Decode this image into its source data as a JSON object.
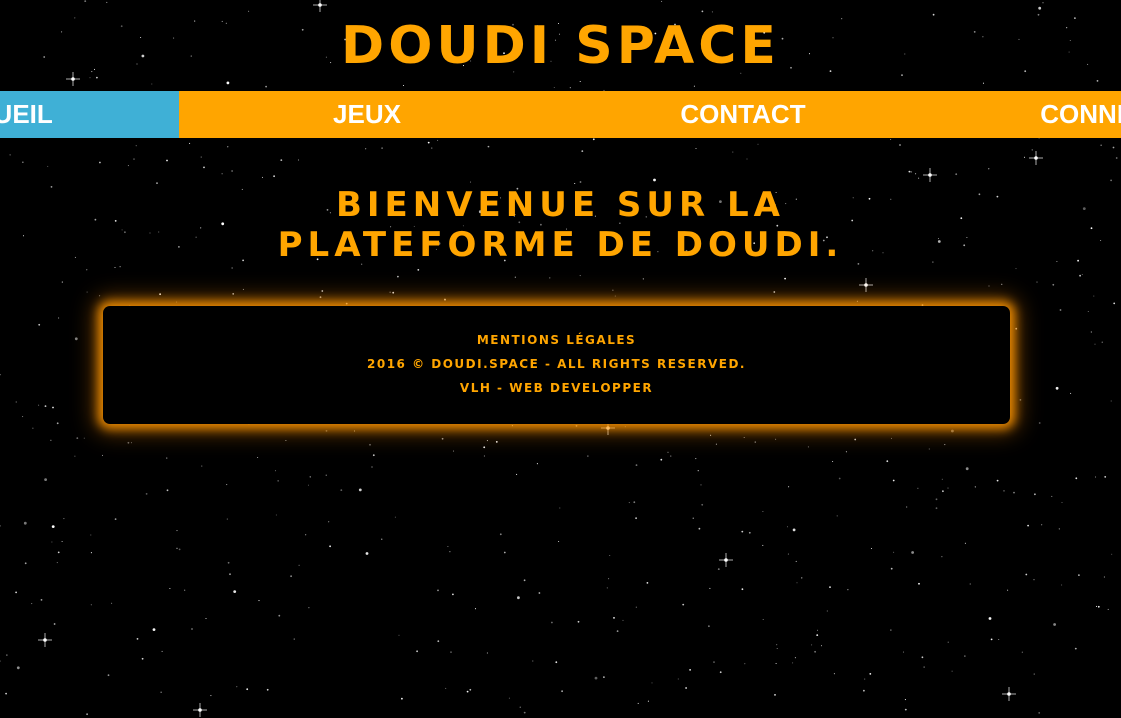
{
  "site": {
    "title": "DOUDI SPACE"
  },
  "nav": {
    "items": [
      {
        "label": "ACCUEIL",
        "active": true
      },
      {
        "label": "JEUX",
        "active": false
      },
      {
        "label": "CONTACT",
        "active": false
      },
      {
        "label": "CONNEXION",
        "active": false
      }
    ]
  },
  "main": {
    "welcome_line1": "Bienvenue sur la",
    "welcome_line2": "plateforme de Doudi."
  },
  "footer": {
    "legal_link": "Mentions légales",
    "copyright": "2016 © Doudi.space - All rights reserved.",
    "credit": "VLH - Web developper"
  },
  "colors": {
    "background": "#000000",
    "accent": "#FFA500",
    "nav_active": "#3FB0D6",
    "nav_text": "#FFFFFF",
    "glow": "#FF9600"
  }
}
